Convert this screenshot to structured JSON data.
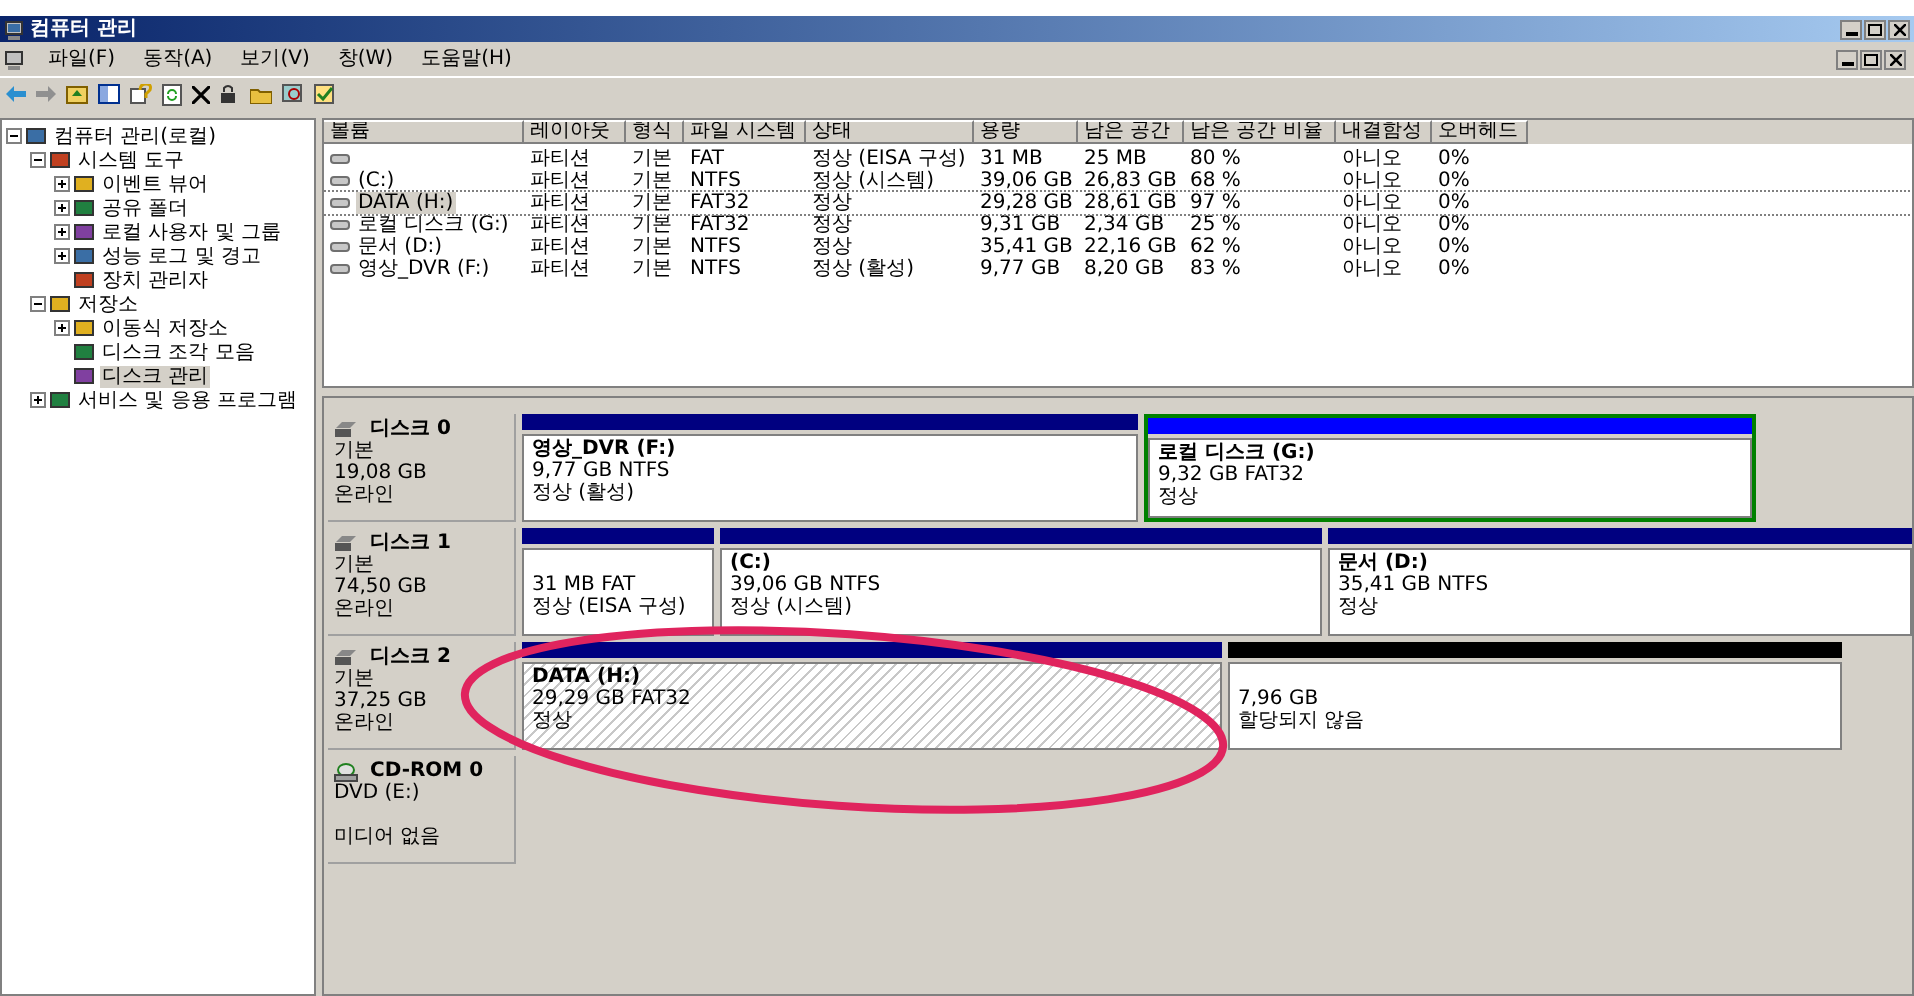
{
  "window": {
    "title": "컴퓨터 관리"
  },
  "menu": [
    "파일(F)",
    "동작(A)",
    "보기(V)",
    "창(W)",
    "도움말(H)"
  ],
  "tree": [
    {
      "label": "컴퓨터 관리(로컬)",
      "selected": false,
      "expanded": true,
      "children": [
        {
          "label": "시스템 도구",
          "selected": false,
          "expanded": true,
          "children": [
            {
              "label": "이벤트 뷰어",
              "selected": false,
              "expanded": false
            },
            {
              "label": "공유 폴더",
              "selected": false,
              "expanded": false
            },
            {
              "label": "로컬 사용자 및 그룹",
              "selected": false,
              "expanded": false
            },
            {
              "label": "성능 로그 및 경고",
              "selected": false,
              "expanded": false
            },
            {
              "label": "장치 관리자",
              "selected": false
            }
          ]
        },
        {
          "label": "저장소",
          "selected": false,
          "expanded": true,
          "children": [
            {
              "label": "이동식 저장소",
              "selected": false,
              "expanded": false
            },
            {
              "label": "디스크 조각 모음",
              "selected": false
            },
            {
              "label": "디스크 관리",
              "selected": true
            }
          ]
        },
        {
          "label": "서비스 및 응용 프로그램",
          "selected": false,
          "expanded": false
        }
      ]
    }
  ],
  "table": {
    "columns": [
      "볼륨",
      "레이아웃",
      "형식",
      "파일 시스템",
      "상태",
      "용량",
      "남은 공간",
      "남은 공간 비율",
      "내결함성",
      "오버헤드"
    ],
    "rows": [
      {
        "selected": false,
        "cells": [
          "",
          "파티션",
          "기본",
          "FAT",
          "정상 (EISA 구성)",
          "31 MB",
          "25 MB",
          "80 %",
          "아니오",
          "0%"
        ]
      },
      {
        "selected": false,
        "cells": [
          "(C:)",
          "파티션",
          "기본",
          "NTFS",
          "정상 (시스템)",
          "39,06 GB",
          "26,83 GB",
          "68 %",
          "아니오",
          "0%"
        ]
      },
      {
        "selected": true,
        "cells": [
          "DATA (H:)",
          "파티션",
          "기본",
          "FAT32",
          "정상",
          "29,28 GB",
          "28,61 GB",
          "97 %",
          "아니오",
          "0%"
        ]
      },
      {
        "selected": false,
        "cells": [
          "로컬 디스크 (G:)",
          "파티션",
          "기본",
          "FAT32",
          "정상",
          "9,31 GB",
          "2,34 GB",
          "25 %",
          "아니오",
          "0%"
        ]
      },
      {
        "selected": false,
        "cells": [
          "문서 (D:)",
          "파티션",
          "기본",
          "NTFS",
          "정상",
          "35,41 GB",
          "22,16 GB",
          "62 %",
          "아니오",
          "0%"
        ]
      },
      {
        "selected": false,
        "cells": [
          "영상_DVR (F:)",
          "파티션",
          "기본",
          "NTFS",
          "정상 (활성)",
          "9,77 GB",
          "8,20 GB",
          "83 %",
          "아니오",
          "0%"
        ]
      }
    ]
  },
  "disks": [
    {
      "kind": "disk",
      "name": "디스크 0",
      "lines": [
        "기본",
        "19,08 GB",
        "온라인"
      ],
      "partitions": [
        {
          "kind": "primary",
          "selected": false,
          "title": "영상_DVR  (F:)",
          "lines": [
            "9,77 GB NTFS",
            "정상 (활성)"
          ]
        },
        {
          "kind": "logical",
          "selected": false,
          "title": "로컬 디스크  (G:)",
          "lines": [
            "9,32 GB FAT32",
            "정상"
          ]
        }
      ]
    },
    {
      "kind": "disk",
      "name": "디스크 1",
      "lines": [
        "기본",
        "74,50 GB",
        "온라인"
      ],
      "partitions": [
        {
          "kind": "primary",
          "selected": false,
          "lines": [
            "31 MB FAT",
            "정상 (EISA 구성)"
          ]
        },
        {
          "kind": "primary",
          "selected": false,
          "title": "(C:)",
          "lines": [
            "39,06 GB NTFS",
            "정상 (시스템)"
          ]
        },
        {
          "kind": "primary",
          "selected": false,
          "title": "문서  (D:)",
          "lines": [
            "35,41 GB NTFS",
            "정상"
          ]
        }
      ]
    },
    {
      "kind": "disk",
      "name": "디스크 2",
      "lines": [
        "기본",
        "37,25 GB",
        "온라인"
      ],
      "partitions": [
        {
          "kind": "primary",
          "selected": true,
          "title": "DATA  (H:)",
          "lines": [
            "29,29 GB FAT32",
            "정상"
          ]
        },
        {
          "kind": "unallocated",
          "selected": false,
          "lines": [
            "7,96 GB",
            "할당되지 않음"
          ]
        }
      ]
    },
    {
      "kind": "cdrom",
      "name": "CD-ROM 0",
      "lines": [
        "DVD (E:)",
        "미디어 없음"
      ]
    }
  ],
  "highlight": {
    "kind": "ellipse"
  }
}
